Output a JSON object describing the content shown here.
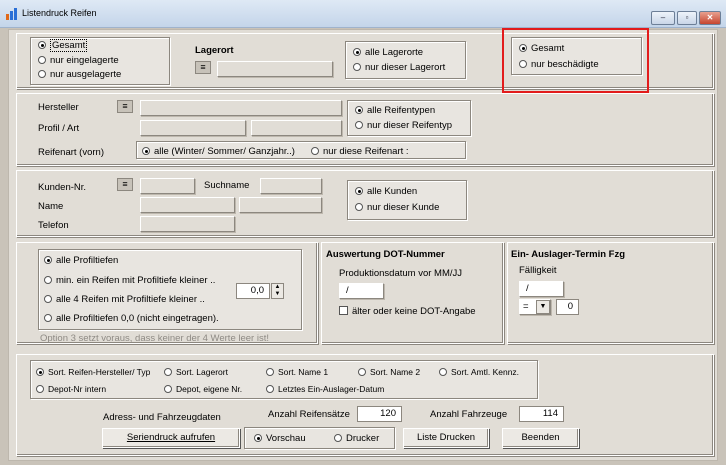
{
  "window": {
    "title": "Listendruck Reifen",
    "minimize": "–",
    "maximize": "▫",
    "close": "✕"
  },
  "lager": {
    "options": [
      "Gesamt",
      "nur eingelagerte",
      "nur ausgelagerte"
    ],
    "lagerort_label": "Lagerort",
    "lagerort_options": [
      "alle Lagerorte",
      "nur dieser Lagerort"
    ],
    "damage_options": [
      "Gesamt",
      "nur beschädigte"
    ]
  },
  "reifen": {
    "hersteller_label": "Hersteller",
    "profil_label": "Profil / Art",
    "typ_options": [
      "alle Reifentypen",
      "nur dieser Reifentyp"
    ],
    "reifenart_label": "Reifenart (vorn)",
    "reifenart_options": [
      "alle (Winter/ Sommer/ Ganzjahr..)",
      "nur diese Reifenart :"
    ]
  },
  "kunden": {
    "kundennr_label": "Kunden-Nr.",
    "suchname_label": "Suchname",
    "name_label": "Name",
    "telefon_label": "Telefon",
    "options": [
      "alle Kunden",
      "nur dieser Kunde"
    ]
  },
  "profil": {
    "options": [
      "alle Profiltiefen",
      "min. ein Reifen mit Profiltiefe kleiner ..",
      "alle 4 Reifen mit Profiltiefe kleiner ..",
      "alle Profiltiefen 0,0 (nicht eingetragen)."
    ],
    "value": "0,0",
    "note": "Option 3 setzt voraus, dass keiner der 4 Werte leer ist!"
  },
  "dot": {
    "title": "Auswertung DOT-Nummer",
    "date_label": "Produktionsdatum vor MM/JJ",
    "date_value": "/",
    "older_label": "älter oder keine DOT-Angabe"
  },
  "termin": {
    "title": "Ein- Auslager-Termin Fzg",
    "faelligkeit_label": "Fälligkeit",
    "date_value": "/",
    "operator": "=",
    "number": "0"
  },
  "sort": {
    "options": [
      "Sort. Reifen-Hersteller/ Typ",
      "Sort. Lagerort",
      "Sort. Name 1",
      "Sort. Name 2",
      "Sort. Amtl. Kennz.",
      "Depot-Nr intern",
      "Depot, eigene Nr.",
      "Letztes Ein-Auslager-Datum"
    ]
  },
  "footer": {
    "adress_label": "Adress- und Fahrzeugdaten",
    "reifensaetze_label": "Anzahl Reifensätze",
    "reifensaetze_value": "120",
    "fahrzeuge_label": "Anzahl Fahrzeuge",
    "fahrzeuge_value": "114",
    "serien_button": "Seriendruck aufrufen",
    "vorschau_label": "Vorschau",
    "drucker_label": "Drucker",
    "liste_button": "Liste Drucken",
    "beenden_button": "Beenden"
  }
}
